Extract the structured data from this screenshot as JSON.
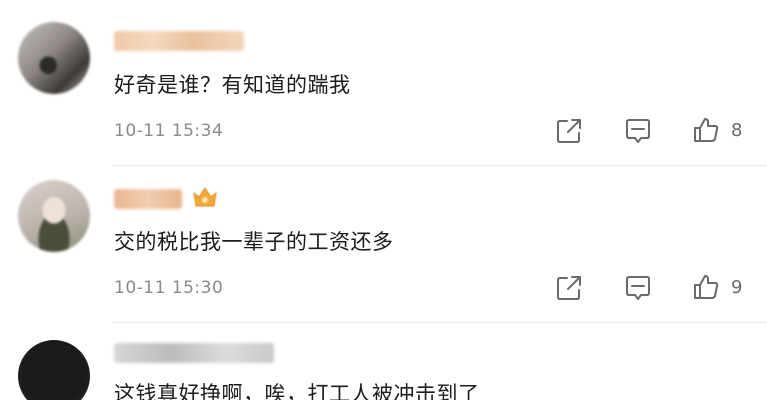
{
  "comments": [
    {
      "text": "好奇是谁？有知道的踹我",
      "timestamp": "10-11 15:34",
      "likes": "8"
    },
    {
      "text": "交的税比我一辈子的工资还多",
      "timestamp": "10-11 15:30",
      "likes": "9"
    },
    {
      "text": "这钱真好挣啊，唉，打工人被冲击到了"
    }
  ],
  "icons": {
    "share": "share-icon",
    "reply": "comment-icon",
    "like": "thumbs-up-icon"
  },
  "colors": {
    "text": "#1c1c1c",
    "meta": "#8a8a8a",
    "icon": "#6a6a6a",
    "background": "#ffffff"
  }
}
